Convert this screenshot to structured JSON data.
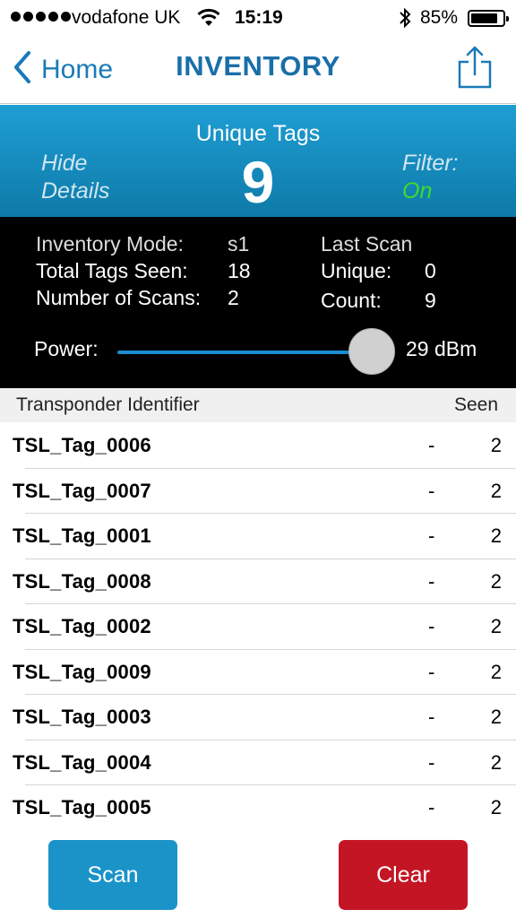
{
  "status_bar": {
    "carrier": "vodafone UK",
    "time": "15:19",
    "battery_percent": "85%",
    "battery_level": 0.85,
    "icons": [
      "signal-dots-icon",
      "wifi-icon",
      "bluetooth-icon",
      "battery-icon"
    ]
  },
  "nav": {
    "back_label": "Home",
    "title": "INVENTORY",
    "share_icon": "share-icon"
  },
  "summary": {
    "hide_details_line1": "Hide",
    "hide_details_line2": "Details",
    "unique_tags_label": "Unique Tags",
    "unique_tags_value": "9",
    "filter_label": "Filter:",
    "filter_value": "On"
  },
  "stats": {
    "inventory_mode_label": "Inventory Mode:",
    "inventory_mode_value": "s1",
    "total_tags_label": "Total Tags Seen:",
    "total_tags_value": "18",
    "num_scans_label": "Number of Scans:",
    "num_scans_value": "2",
    "last_scan_label": "Last Scan",
    "unique_label": "Unique:",
    "unique_value": "0",
    "count_label": "Count:",
    "count_value": "9",
    "power_label": "Power:",
    "power_value": "29 dBm",
    "power_level": 1.0
  },
  "table": {
    "col_identifier": "Transponder Identifier",
    "col_seen": "Seen",
    "rows": [
      {
        "id": "TSL_Tag_0006",
        "last": "-",
        "seen": "2"
      },
      {
        "id": "TSL_Tag_0007",
        "last": "-",
        "seen": "2"
      },
      {
        "id": "TSL_Tag_0001",
        "last": "-",
        "seen": "2"
      },
      {
        "id": "TSL_Tag_0008",
        "last": "-",
        "seen": "2"
      },
      {
        "id": "TSL_Tag_0002",
        "last": "-",
        "seen": "2"
      },
      {
        "id": "TSL_Tag_0009",
        "last": "-",
        "seen": "2"
      },
      {
        "id": "TSL_Tag_0003",
        "last": "-",
        "seen": "2"
      },
      {
        "id": "TSL_Tag_0004",
        "last": "-",
        "seen": "2"
      },
      {
        "id": "TSL_Tag_0005",
        "last": "-",
        "seen": "2"
      }
    ]
  },
  "buttons": {
    "scan_label": "Scan",
    "clear_label": "Clear"
  },
  "colors": {
    "accent_blue": "#1a7ab8",
    "header_blue": "#1f9ed4",
    "filter_on_green": "#3ddc2a",
    "scan_button": "#1a93c9",
    "clear_button": "#c41524"
  }
}
